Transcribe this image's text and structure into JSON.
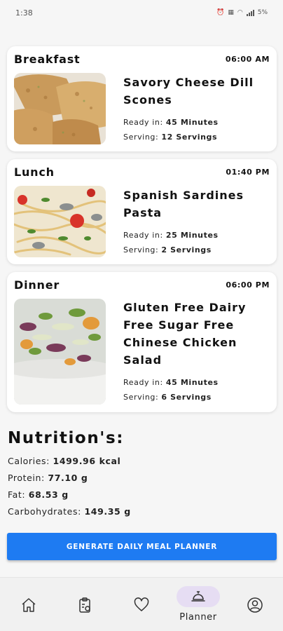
{
  "status_bar": {
    "time": "1:38",
    "battery": "5%"
  },
  "meals": [
    {
      "type": "Breakfast",
      "time": "06:00 AM",
      "title": "Savory Cheese Dill Scones",
      "ready_label": "Ready in:",
      "ready_value": "45 Minutes",
      "serving_label": "Serving:",
      "serving_value": "12 Servings"
    },
    {
      "type": "Lunch",
      "time": "01:40 PM",
      "title": "Spanish Sardines Pasta",
      "ready_label": "Ready in:",
      "ready_value": "25 Minutes",
      "serving_label": "Serving:",
      "serving_value": "2 Servings"
    },
    {
      "type": "Dinner",
      "time": "06:00 PM",
      "title": "Gluten Free Dairy Free Sugar Free Chinese Chicken Salad",
      "ready_label": "Ready in:",
      "ready_value": "45 Minutes",
      "serving_label": "Serving:",
      "serving_value": "6 Servings"
    }
  ],
  "nutrition": {
    "heading": "Nutrition's:",
    "items": [
      {
        "label": "Calories:",
        "value": "1499.96 kcal"
      },
      {
        "label": "Protein:",
        "value": "77.10 g"
      },
      {
        "label": "Fat:",
        "value": "68.53 g"
      },
      {
        "label": "Carbohydrates:",
        "value": "149.35 g"
      }
    ]
  },
  "generate_button_label": "GENERATE DAILY MEAL PLANNER",
  "bottom_nav": {
    "items": [
      {
        "icon": "home-icon"
      },
      {
        "icon": "clipboard-icon"
      },
      {
        "icon": "heart-icon"
      },
      {
        "icon": "cloche-icon",
        "label": "Planner",
        "active": true
      },
      {
        "icon": "profile-icon"
      }
    ]
  },
  "colors": {
    "accent": "#1e7bf2",
    "active_pill": "#e6ddf3",
    "background": "#f6f6f6"
  }
}
